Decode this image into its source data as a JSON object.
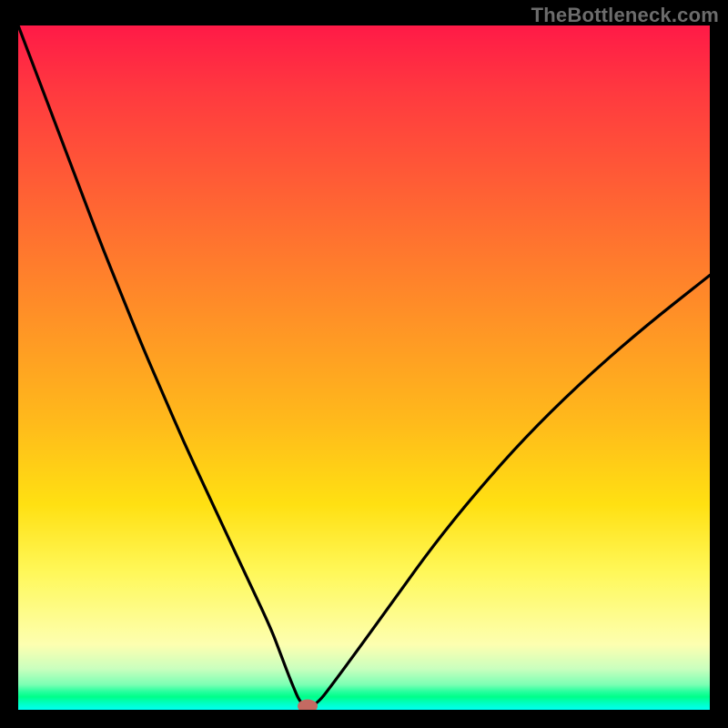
{
  "watermark": "TheBottleneck.com",
  "colors": {
    "page_bg": "#000000",
    "curve": "#000000",
    "marker": "#c46a62",
    "gradient_top": "#ff1a47",
    "gradient_bottom": "#00fff0"
  },
  "chart_data": {
    "type": "line",
    "title": "",
    "xlabel": "",
    "ylabel": "",
    "xlim": [
      0,
      100
    ],
    "ylim": [
      0,
      100
    ],
    "x": [
      0,
      3,
      6,
      9,
      12,
      15,
      18,
      21,
      24,
      27,
      30,
      33,
      36.5,
      38,
      39.5,
      41,
      43,
      46,
      50,
      55,
      60,
      66,
      73,
      81,
      90,
      100
    ],
    "values": [
      100,
      92,
      84,
      76,
      68,
      60.5,
      53,
      46,
      39,
      32.5,
      26,
      19.5,
      12,
      8,
      4,
      0.5,
      0.5,
      4.5,
      10,
      17,
      24,
      31.5,
      39.5,
      47.5,
      55.5,
      63.5
    ],
    "marker": {
      "x": 41.8,
      "y": 0.5
    },
    "notes": "Axis values estimated from pixel positions; no tick labels present in source image."
  }
}
